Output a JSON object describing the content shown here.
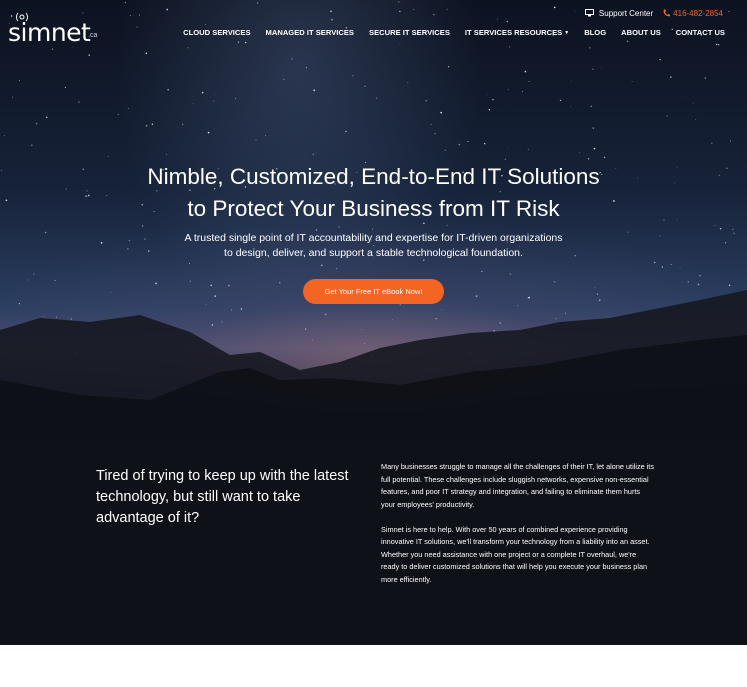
{
  "logo": {
    "word": "simnet",
    "tld": ".ca"
  },
  "topbar": {
    "support_label": "Support Center",
    "phone": "416-482-2854"
  },
  "nav": {
    "items": [
      {
        "label": "CLOUD SERVICES"
      },
      {
        "label": "MANAGED IT SERVICES"
      },
      {
        "label": "SECURE IT SERVICES"
      },
      {
        "label": "IT SERVICES RESOURCES"
      },
      {
        "label": "BLOG"
      },
      {
        "label": "ABOUT US"
      },
      {
        "label": "CONTACT US"
      }
    ]
  },
  "hero": {
    "title_line1": "Nimble, Customized, End-to-End IT Solutions",
    "title_line2": "to Protect Your Business from IT Risk",
    "subtitle_line1": "A trusted single point of IT accountability and expertise for IT-driven organizations",
    "subtitle_line2": "to design, deliver, and support a stable technological foundation.",
    "cta_label": "Get Your Free IT eBook Now!"
  },
  "intro": {
    "heading": "Tired of trying to keep up with the latest technology, but still want to take advantage of it?",
    "paragraph1": "Many businesses struggle to manage all the challenges of their IT, let alone utilize its full potential. These challenges include sluggish networks, expensive non-essential features, and poor IT strategy and integration, and failing to eliminate them hurts your employees' productivity.",
    "paragraph2": "Simnet is here to help. With over 50 years of combined experience providing innovative IT solutions, we'll transform your technology from a liability into an asset. Whether you need assistance with one project or a complete IT overhaul, we're ready to deliver customized solutions that will help you execute your business plan more efficiently."
  },
  "colors": {
    "accent": "#f26522",
    "text": "#ffffff"
  },
  "icons": {
    "support": "monitor-icon",
    "phone": "phone-icon",
    "dropdown": "chevron-down-icon"
  }
}
